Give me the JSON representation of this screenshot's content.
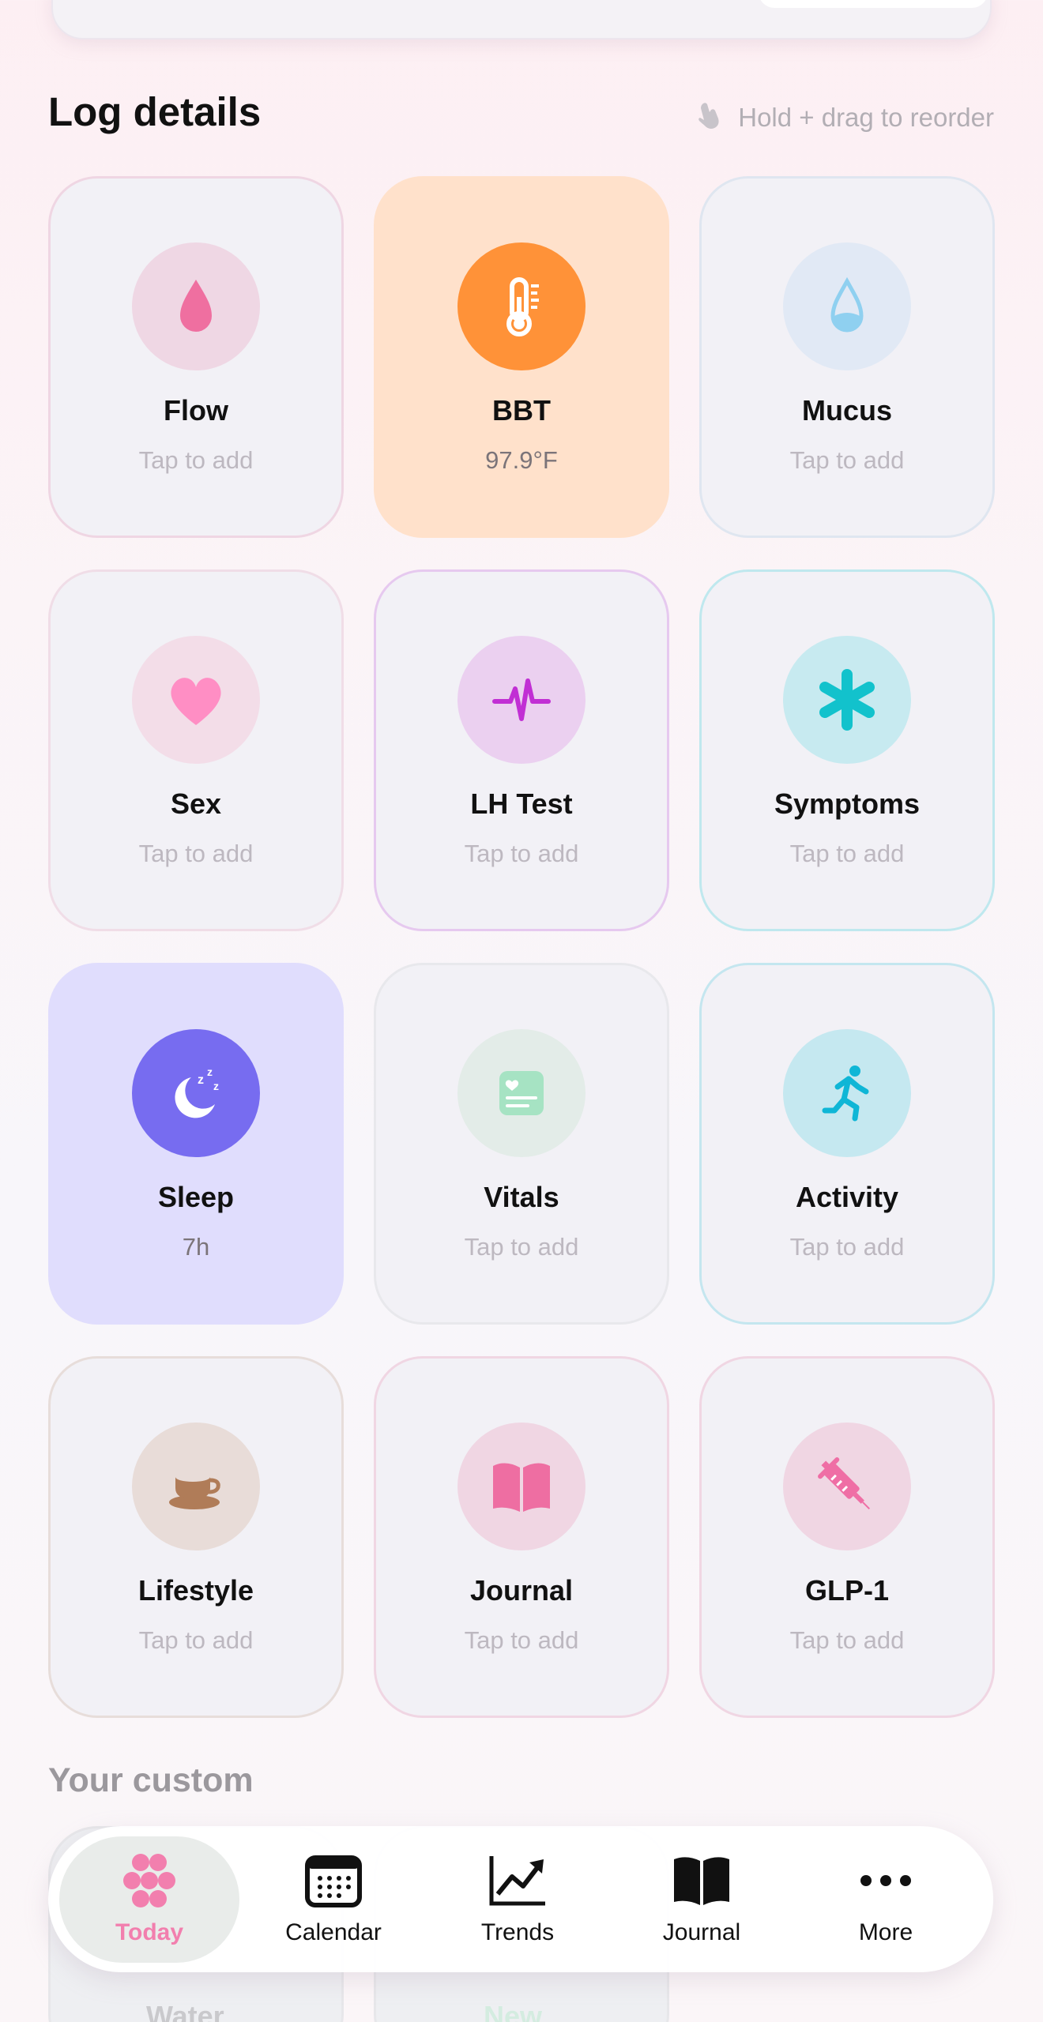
{
  "header": {
    "title": "Log details",
    "hint": "Hold + drag to reorder"
  },
  "tiles": [
    {
      "label": "Flow",
      "sub": "Tap to add",
      "icon": "drop-icon",
      "color": "#ef6fa0",
      "circle": "#efd7e4",
      "bg": "#f2f1f6",
      "border": "#efd6e3"
    },
    {
      "label": "BBT",
      "sub": "97.9°F",
      "icon": "thermometer-icon",
      "color": "#ffffff",
      "circle": "#ff9238",
      "bg": "#ffe1cb",
      "border": "#ffe1cb"
    },
    {
      "label": "Mucus",
      "sub": "Tap to add",
      "icon": "water-drop-icon",
      "color": "#8fd0f0",
      "circle": "#e1e9f5",
      "bg": "#f2f1f6",
      "border": "#dfe6f0"
    },
    {
      "label": "Sex",
      "sub": "Tap to add",
      "icon": "heart-icon",
      "color": "#ff8ec4",
      "circle": "#f3dde8",
      "bg": "#f2f1f6",
      "border": "#f0dde7"
    },
    {
      "label": "LH Test",
      "sub": "Tap to add",
      "icon": "pulse-icon",
      "color": "#c12fd4",
      "circle": "#ebd0f0",
      "bg": "#f2f1f6",
      "border": "#e6c9ef"
    },
    {
      "label": "Symptoms",
      "sub": "Tap to add",
      "icon": "asterisk-icon",
      "color": "#12c2cc",
      "circle": "#c7eaf0",
      "bg": "#f2f1f6",
      "border": "#bfe8ee"
    },
    {
      "label": "Sleep",
      "sub": "7h",
      "icon": "moon-icon",
      "color": "#ffffff",
      "circle": "#776cf0",
      "bg": "#e0ddfd",
      "border": "#e0ddfd"
    },
    {
      "label": "Vitals",
      "sub": "Tap to add",
      "icon": "vitals-card-icon",
      "color": "#a6e3c3",
      "circle": "#e3ece8",
      "bg": "#f2f1f6",
      "border": "#e8e8ec"
    },
    {
      "label": "Activity",
      "sub": "Tap to add",
      "icon": "running-icon",
      "color": "#0fb6d6",
      "circle": "#c5e8f0",
      "bg": "#f2f1f6",
      "border": "#c4e6ef"
    },
    {
      "label": "Lifestyle",
      "sub": "Tap to add",
      "icon": "coffee-cup-icon",
      "color": "#b07c58",
      "circle": "#e8dcd8",
      "bg": "#f2f1f6",
      "border": "#e7ddda"
    },
    {
      "label": "Journal",
      "sub": "Tap to add",
      "icon": "book-icon",
      "color": "#ee6ea2",
      "circle": "#f0d6e3",
      "bg": "#f2f1f6",
      "border": "#f0d6e3"
    },
    {
      "label": "GLP-1",
      "sub": "Tap to add",
      "icon": "syringe-icon",
      "color": "#ef6ea5",
      "circle": "#f0d6e3",
      "bg": "#f2f1f6",
      "border": "#f0d6e3"
    }
  ],
  "custom": {
    "title": "Your custom",
    "peek_labels": [
      "Water",
      "New"
    ]
  },
  "tabbar": {
    "items": [
      {
        "label": "Today",
        "icon": "flower-dots-icon",
        "selected": true
      },
      {
        "label": "Calendar",
        "icon": "calendar-icon",
        "selected": false
      },
      {
        "label": "Trends",
        "icon": "chart-trend-icon",
        "selected": false
      },
      {
        "label": "Journal",
        "icon": "book-icon",
        "selected": false
      },
      {
        "label": "More",
        "icon": "ellipsis-icon",
        "selected": false
      }
    ],
    "accent": "#f27fae"
  }
}
